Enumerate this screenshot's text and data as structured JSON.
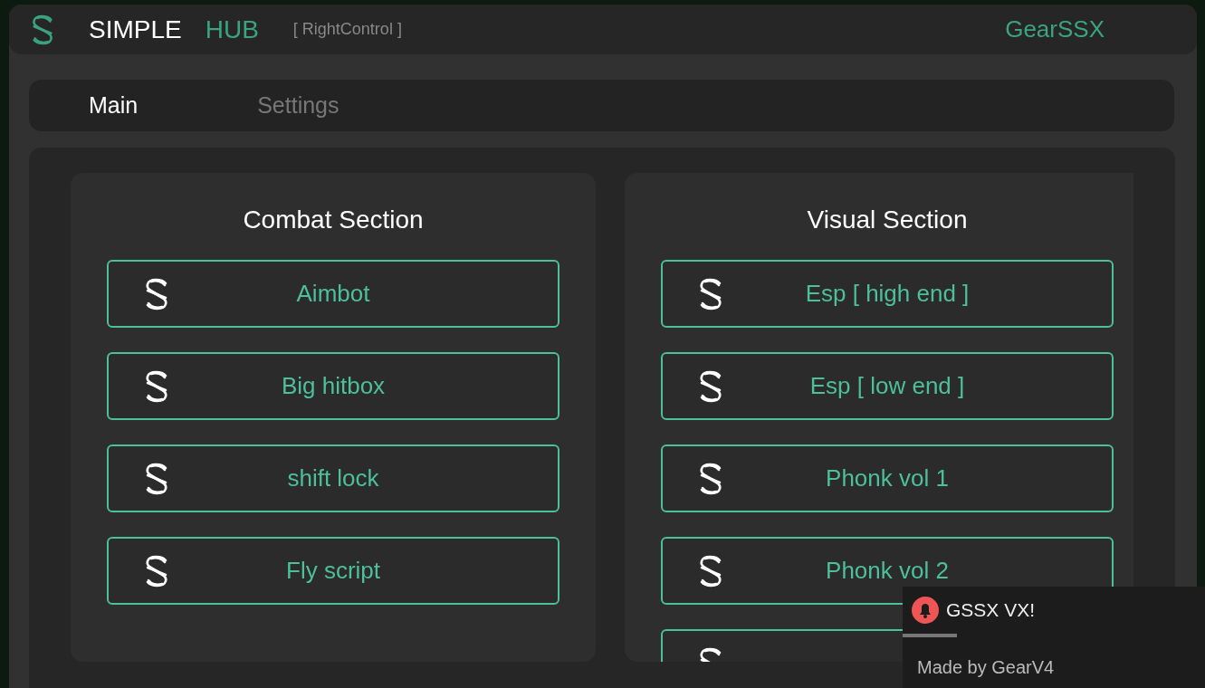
{
  "window": {
    "title": "SIMPLE",
    "title_accent": "HUB",
    "keybind": "[ RightControl ]",
    "author": "GearSSX"
  },
  "tabs": [
    {
      "label": "Main",
      "selected": true
    },
    {
      "label": "Settings",
      "selected": false
    }
  ],
  "sections": [
    {
      "title": "Combat Section",
      "buttons": [
        {
          "kind": "full",
          "label": "Aimbot"
        },
        {
          "kind": "full",
          "label": "Big hitbox"
        },
        {
          "kind": "full",
          "label": "shift lock"
        },
        {
          "kind": "full",
          "label": "Fly script"
        }
      ]
    },
    {
      "title": "Visual Section",
      "buttons": [
        {
          "kind": "full",
          "label": "Esp [ high end ]"
        },
        {
          "kind": "full",
          "label": "Esp [ low end ]"
        },
        {
          "kind": "full",
          "label": "Phonk vol 1"
        },
        {
          "kind": "full",
          "label": "Phonk vol 2"
        },
        {
          "kind": "cut"
        }
      ]
    }
  ],
  "notification": {
    "title": "GSSX VX!",
    "message": "Made by GearV4",
    "level": 0.18
  }
}
